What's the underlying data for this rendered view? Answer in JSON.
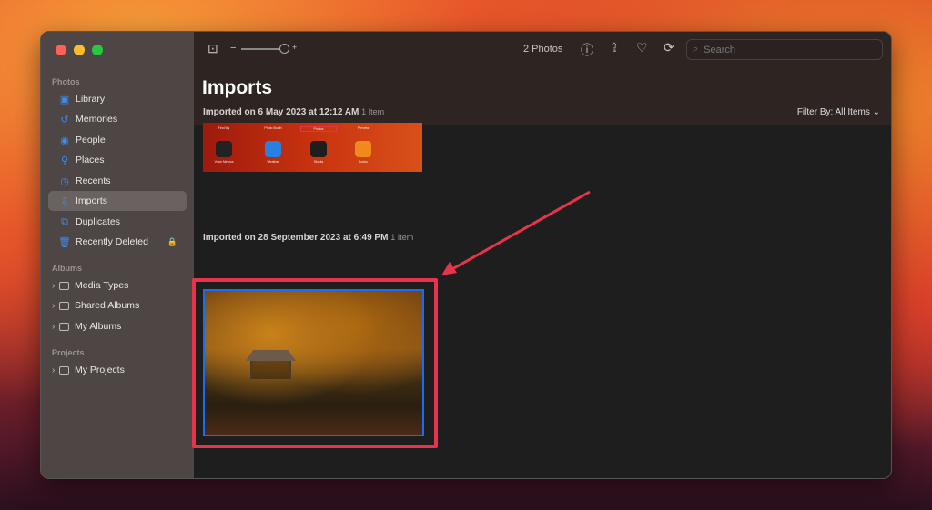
{
  "sidebar": {
    "photos_header": "Photos",
    "items": [
      {
        "label": "Library",
        "icon": "library-icon"
      },
      {
        "label": "Memories",
        "icon": "memories-icon"
      },
      {
        "label": "People",
        "icon": "people-icon"
      },
      {
        "label": "Places",
        "icon": "places-icon"
      },
      {
        "label": "Recents",
        "icon": "recents-icon"
      },
      {
        "label": "Imports",
        "icon": "imports-icon",
        "selected": true
      },
      {
        "label": "Duplicates",
        "icon": "duplicates-icon"
      },
      {
        "label": "Recently Deleted",
        "icon": "trash-icon",
        "locked": true
      }
    ],
    "albums_header": "Albums",
    "albums": [
      {
        "label": "Media Types"
      },
      {
        "label": "Shared Albums"
      },
      {
        "label": "My Albums"
      }
    ],
    "projects_header": "Projects",
    "projects": [
      {
        "label": "My Projects"
      }
    ]
  },
  "toolbar": {
    "zoom_minus": "−",
    "zoom_plus": "+",
    "count": "2 Photos",
    "search_placeholder": "Search",
    "zoom_level": 0.85
  },
  "main": {
    "title": "Imports",
    "filter": "Filter By: All Items",
    "groups": [
      {
        "title": "Imported on 6 May 2023 at 12:12 AM",
        "count": "1 Item",
        "apps_top": [
          "Find My",
          "Photo Booth",
          "Photos",
          "Preview"
        ],
        "apps": [
          "Voice Memos",
          "Weather",
          "Stocks",
          "Books"
        ]
      },
      {
        "title": "Imported on 28 September 2023 at 6:49 PM",
        "count": "1 Item"
      }
    ]
  },
  "colors": {
    "highlight": "#e8344a",
    "selection": "#1a6cf0",
    "accent": "#3a8ef6"
  }
}
